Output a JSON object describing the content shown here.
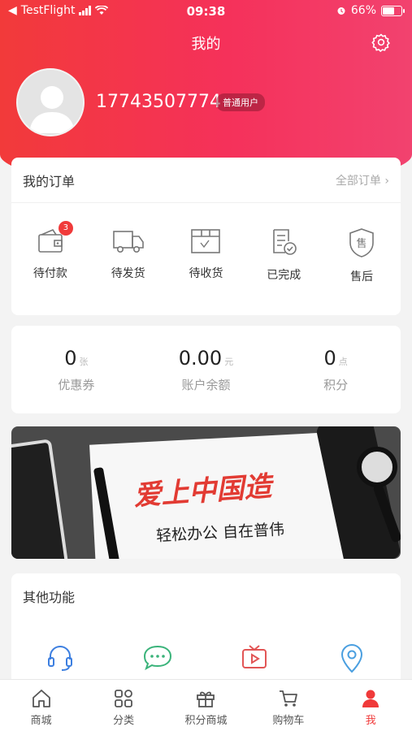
{
  "status_bar": {
    "carrier": "TestFlight",
    "time": "09:38",
    "battery": "66%",
    "battery_level": 0.66
  },
  "header": {
    "title": "我的"
  },
  "user": {
    "phone": "17743507774",
    "badge": "普通用户"
  },
  "orders": {
    "title": "我的订单",
    "all_link": "全部订单 ›",
    "items": [
      {
        "label": "待付款",
        "icon": "wallet-icon",
        "badge": "3"
      },
      {
        "label": "待发货",
        "icon": "truck-icon"
      },
      {
        "label": "待收货",
        "icon": "box-icon"
      },
      {
        "label": "已完成",
        "icon": "document-check-icon"
      },
      {
        "label": "售后",
        "icon": "shield-icon",
        "icon_text": "售"
      }
    ]
  },
  "assets": [
    {
      "value": "0",
      "unit": "张",
      "label": "优惠券"
    },
    {
      "value": "0.00",
      "unit": "元",
      "label": "账户余额"
    },
    {
      "value": "0",
      "unit": "点",
      "label": "积分"
    }
  ],
  "banner": {
    "headline": "爱上中国造",
    "subtitle": "轻松办公 自在普伟"
  },
  "other": {
    "title": "其他功能",
    "icons": [
      "headset-icon",
      "chat-icon",
      "tv-icon",
      "location-icon"
    ]
  },
  "tabbar": [
    {
      "label": "商城",
      "icon": "home-icon"
    },
    {
      "label": "分类",
      "icon": "grid-icon"
    },
    {
      "label": "积分商城",
      "icon": "gift-icon"
    },
    {
      "label": "购物车",
      "icon": "cart-icon"
    },
    {
      "label": "我",
      "icon": "person-icon",
      "active": true
    }
  ],
  "colors": {
    "accent": "#f03a3a",
    "gradient_start": "#f23a3a",
    "gradient_end": "#f2426f"
  }
}
